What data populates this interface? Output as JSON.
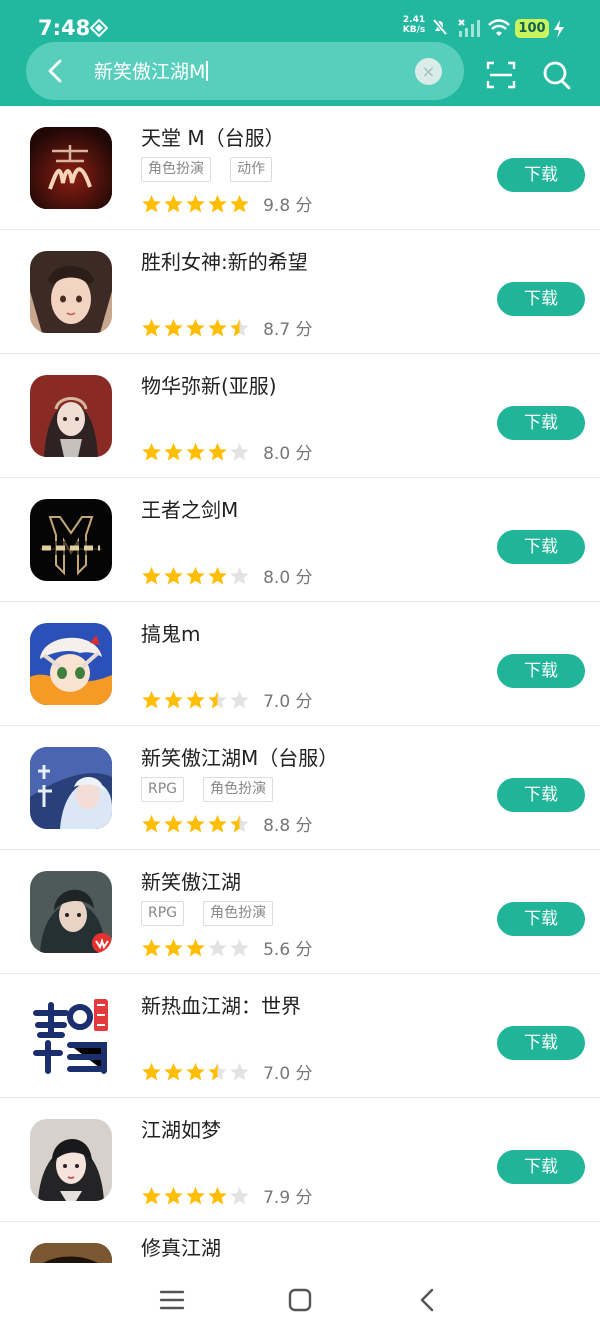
{
  "status": {
    "time": "7:48",
    "speed_value": "2.41",
    "speed_unit": "KB/s",
    "battery": "100"
  },
  "search": {
    "query": "新笑傲江湖M",
    "clear_symbol": "×"
  },
  "colors": {
    "header_bg": "#22b79f",
    "button_bg": "#20b499",
    "star_on": "#ffbf00",
    "star_off": "#e3e3e3"
  },
  "apps": [
    {
      "title": "天堂 M（台服）",
      "tags": [
        "角色扮演",
        "动作"
      ],
      "rating": 5,
      "score": "9.8 分",
      "download_label": "下载"
    },
    {
      "title": "胜利女神:新的希望",
      "tags": [],
      "rating": 4.5,
      "score": "8.7 分",
      "download_label": "下载"
    },
    {
      "title": "物华弥新(亚服)",
      "tags": [],
      "rating": 4,
      "score": "8.0 分",
      "download_label": "下载"
    },
    {
      "title": "王者之剑M",
      "tags": [],
      "rating": 4,
      "score": "8.0 分",
      "download_label": "下载"
    },
    {
      "title": "搞鬼m",
      "tags": [],
      "rating": 3.5,
      "score": "7.0 分",
      "download_label": "下载"
    },
    {
      "title": "新笑傲江湖M（台服）",
      "tags": [
        "RPG",
        "角色扮演"
      ],
      "rating": 4.5,
      "score": "8.8 分",
      "download_label": "下载"
    },
    {
      "title": "新笑傲江湖",
      "tags": [
        "RPG",
        "角色扮演"
      ],
      "rating": 3,
      "score": "5.6 分",
      "download_label": "下载"
    },
    {
      "title": "新热血江湖：世界",
      "tags": [],
      "rating": 3.5,
      "score": "7.0 分",
      "download_label": "下载"
    },
    {
      "title": "江湖如梦",
      "tags": [],
      "rating": 4,
      "score": "7.9 分",
      "download_label": "下载"
    },
    {
      "title": "修真江湖",
      "tags": [],
      "rating": 0,
      "score": "",
      "download_label": ""
    }
  ],
  "navigation": {
    "menu_icon": "menu-icon",
    "home_icon": "home-icon",
    "back_icon": "back-arrow-icon"
  }
}
